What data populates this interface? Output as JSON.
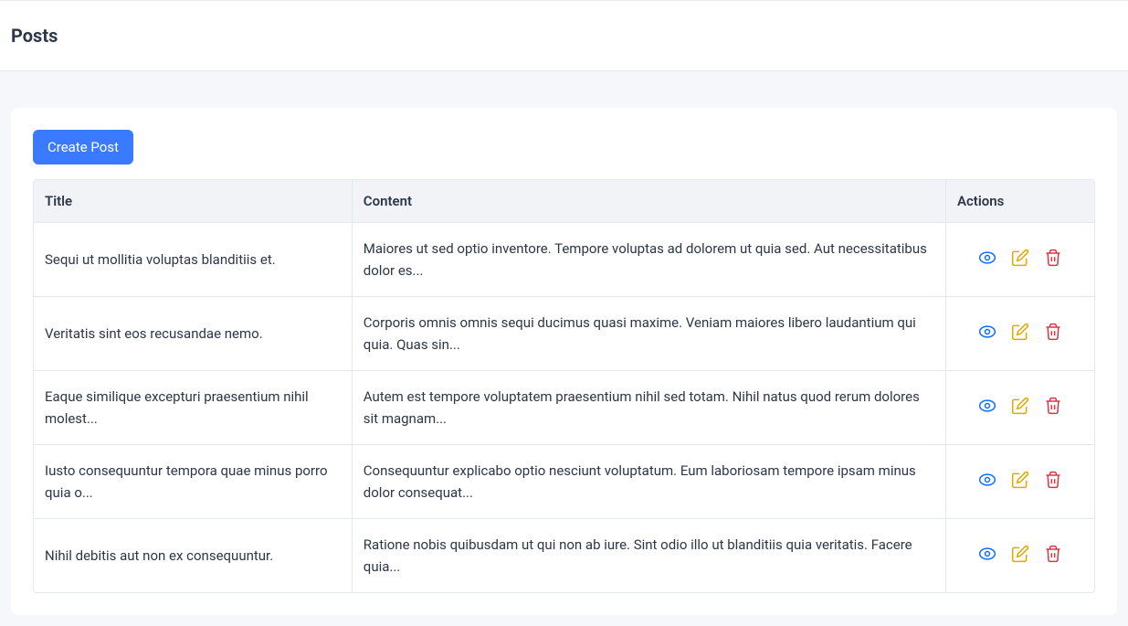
{
  "header": {
    "title": "Posts"
  },
  "toolbar": {
    "create_label": "Create Post"
  },
  "table": {
    "columns": {
      "title": "Title",
      "content": "Content",
      "actions": "Actions"
    },
    "rows": [
      {
        "title": "Sequi ut mollitia voluptas blanditiis et.",
        "content": "Maiores ut sed optio inventore. Tempore voluptas ad dolorem ut quia sed. Aut necessitatibus dolor es..."
      },
      {
        "title": "Veritatis sint eos recusandae nemo.",
        "content": "Corporis omnis omnis sequi ducimus quasi maxime. Veniam maiores libero laudantium qui quia. Quas sin..."
      },
      {
        "title": "Eaque similique excepturi praesentium nihil molest...",
        "content": "Autem est tempore voluptatem praesentium nihil sed totam. Nihil natus quod rerum dolores sit magnam..."
      },
      {
        "title": "Iusto consequuntur tempora quae minus porro quia o...",
        "content": "Consequuntur explicabo optio nesciunt voluptatum. Eum laboriosam tempore ipsam minus dolor consequat..."
      },
      {
        "title": "Nihil debitis aut non ex consequuntur.",
        "content": "Ratione nobis quibusdam ut qui non ab iure. Sint odio illo ut blanditiis quia veritatis. Facere quia..."
      }
    ]
  },
  "icons": {
    "view": "eye-icon",
    "edit": "edit-icon",
    "delete": "trash-icon"
  }
}
